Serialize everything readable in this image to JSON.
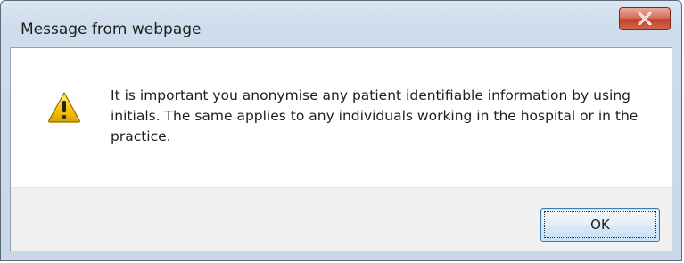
{
  "window": {
    "title": "Message from webpage",
    "close_icon": "close-x-icon"
  },
  "dialog": {
    "icon": "warning-icon",
    "message": "It is important you anonymise any patient identifiable information by using initials. The same applies to any individuals working in the hospital or in the practice."
  },
  "buttons": {
    "ok_label": "OK"
  },
  "colors": {
    "close_button": "#c2412a",
    "warning_fill": "#f5c400",
    "ok_border": "#3c7fb1"
  }
}
